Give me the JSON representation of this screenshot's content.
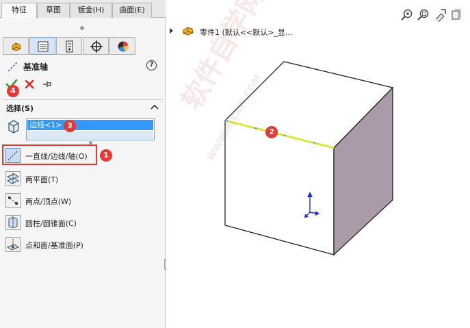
{
  "tabs": [
    {
      "label": "特征",
      "active": true
    },
    {
      "label": "草图",
      "active": false
    },
    {
      "label": "钣金(H)",
      "active": false
    },
    {
      "label": "曲面(E)",
      "active": false
    }
  ],
  "manager_tabs": [
    "feature-manager-icon",
    "property-manager-icon",
    "configuration-manager-icon",
    "dimxpert-icon",
    "display-manager-icon"
  ],
  "property_manager": {
    "title": "基准轴",
    "help": "?",
    "section_title": "选择(S)",
    "selection_item": "边线<1>",
    "options": [
      {
        "label": "一直线/边线/轴(O)",
        "selected": true,
        "icon": "line-edge-axis-icon"
      },
      {
        "label": "两平面(T)",
        "selected": false,
        "icon": "two-planes-icon"
      },
      {
        "label": "两点/顶点(W)",
        "selected": false,
        "icon": "two-points-icon"
      },
      {
        "label": "圆柱/圆锥面(C)",
        "selected": false,
        "icon": "cylinder-cone-icon"
      },
      {
        "label": "点和面/基准面(P)",
        "selected": false,
        "icon": "point-plane-icon"
      }
    ]
  },
  "callouts": [
    "1",
    "2",
    "3",
    "4"
  ],
  "viewport": {
    "tree_label": "零件1  (默认<<默认>_显..."
  },
  "watermark": {
    "text": "软件自学网",
    "url": "WWW.RJZXW.COM"
  },
  "colors": {
    "accent": "#e53935",
    "selection": "#3399ff",
    "edge_highlight": "#e0e63a",
    "cube_side": "#ab9aa7"
  }
}
